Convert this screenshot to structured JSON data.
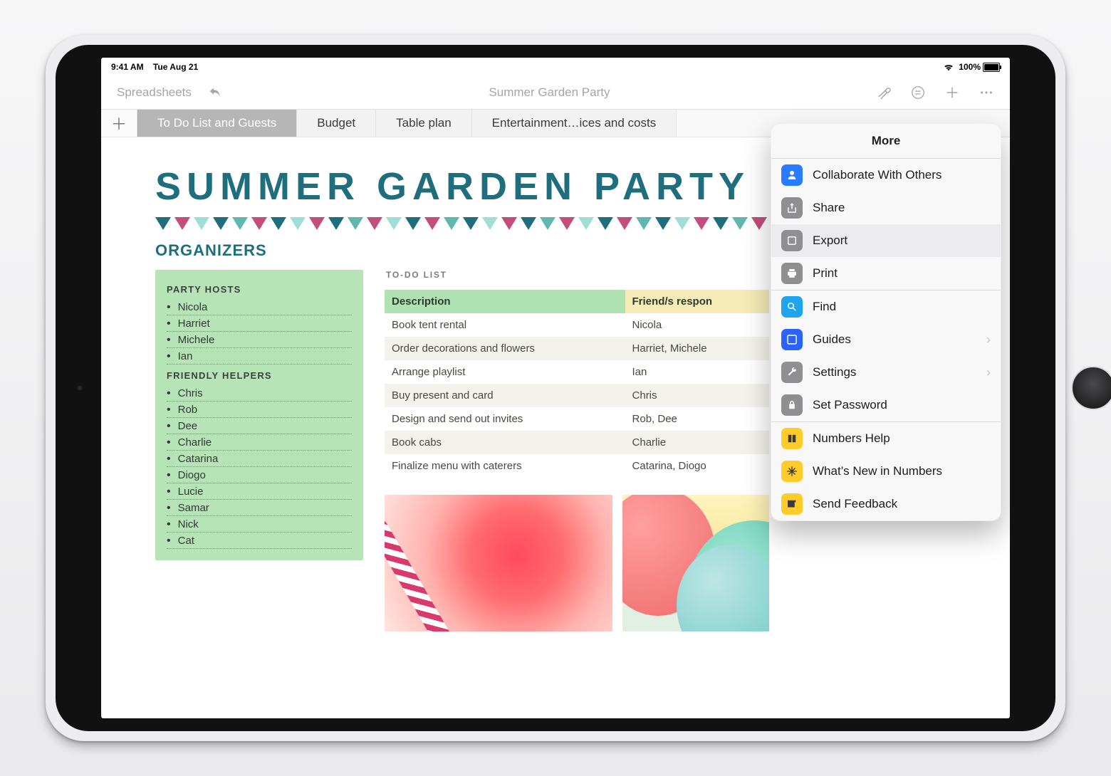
{
  "statusbar": {
    "time": "9:41 AM",
    "date": "Tue Aug 21",
    "battery_pct": "100%"
  },
  "toolbar": {
    "back": "Spreadsheets",
    "title": "Summer Garden Party"
  },
  "sheets": {
    "active": "To Do List and Guests",
    "tabs": [
      "Budget",
      "Table plan",
      "Entertainment…ices and costs"
    ]
  },
  "document": {
    "big_title": "SUMMER GARDEN PARTY",
    "section_head": "ORGANIZERS",
    "org": {
      "hosts_head": "PARTY HOSTS",
      "hosts": [
        "Nicola",
        "Harriet",
        "Michele",
        "Ian"
      ],
      "helpers_head": "FRIENDLY HELPERS",
      "helpers": [
        "Chris",
        "Rob",
        "Dee",
        "Charlie",
        "Catarina",
        "Diogo",
        "Lucie",
        "Samar",
        "Nick",
        "Cat"
      ]
    },
    "todo": {
      "label": "TO-DO LIST",
      "col_desc": "Description",
      "col_resp": "Friend/s respon",
      "rows": [
        {
          "d": "Book tent rental",
          "r": "Nicola"
        },
        {
          "d": "Order decorations and flowers",
          "r": "Harriet, Michele"
        },
        {
          "d": "Arrange playlist",
          "r": "Ian"
        },
        {
          "d": "Buy present and card",
          "r": "Chris"
        },
        {
          "d": "Design and send out invites",
          "r": "Rob, Dee"
        },
        {
          "d": "Book cabs",
          "r": "Charlie"
        },
        {
          "d": "Finalize menu with caterers",
          "r": "Catarina, Diogo"
        }
      ]
    }
  },
  "popover": {
    "title": "More",
    "items": {
      "collaborate": "Collaborate With Others",
      "share": "Share",
      "export": "Export",
      "print": "Print",
      "find": "Find",
      "guides": "Guides",
      "settings": "Settings",
      "setpassword": "Set Password",
      "help": "Numbers Help",
      "whatsnew": "What’s New in Numbers",
      "feedback": "Send Feedback"
    }
  },
  "bunting_colors": [
    "#1f6e7d",
    "#c44d7d",
    "#a0ddd4",
    "#1f6e7d",
    "#5fb7ae",
    "#c44d7d",
    "#1f6e7d",
    "#a0ddd4",
    "#c44d7d",
    "#1f6e7d",
    "#5fb7ae",
    "#c44d7d",
    "#a0ddd4",
    "#1f6e7d",
    "#c44d7d",
    "#5fb7ae",
    "#1f6e7d",
    "#a0ddd4",
    "#c44d7d",
    "#1f6e7d",
    "#5fb7ae",
    "#c44d7d",
    "#a0ddd4",
    "#1f6e7d",
    "#c44d7d",
    "#5fb7ae",
    "#1f6e7d",
    "#a0ddd4",
    "#c44d7d",
    "#1f6e7d",
    "#5fb7ae",
    "#c44d7d",
    "#a0ddd4",
    "#1f6e7d"
  ]
}
